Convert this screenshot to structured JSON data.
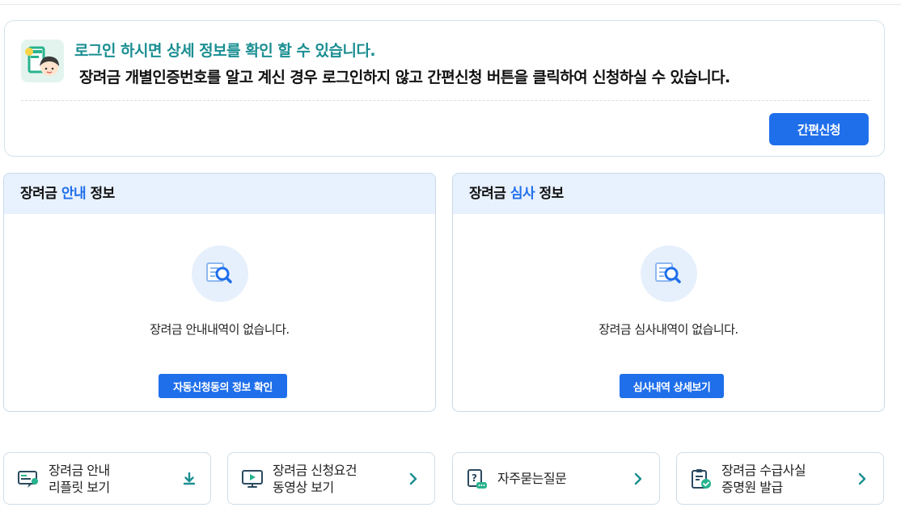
{
  "notice": {
    "title": "로그인 하시면 상세 정보를 확인 할 수 있습니다.",
    "description": "장려금 개별인증번호를 알고 계신 경우 로그인하지 않고 간편신청 버튼을 클릭하여 신청하실 수 있습니다.",
    "quick_apply_label": "간편신청",
    "icon": "person-document-icon"
  },
  "panels": {
    "guide": {
      "title_pre": "장려금 ",
      "title_accent": "안내",
      "title_post": " 정보",
      "empty_text": "장려금 안내내역이 없습니다.",
      "button_label": "자동신청동의 정보 확인",
      "icon": "document-search-icon"
    },
    "review": {
      "title_pre": "장려금 ",
      "title_accent": "심사",
      "title_post": " 정보",
      "empty_text": "장려금 심사내역이 없습니다.",
      "button_label": "심사내역 상세보기",
      "icon": "document-search-icon"
    }
  },
  "quick_links": [
    {
      "line1": "장려금 안내",
      "line2": "리플릿 보기",
      "icon": "leaflet-icon",
      "action_icon": "download-icon"
    },
    {
      "line1": "장려금 신청요건",
      "line2": "동영상 보기",
      "icon": "video-monitor-icon",
      "action_icon": "chevron-right-icon"
    },
    {
      "line1": "자주묻는질문",
      "line2": "",
      "icon": "faq-icon",
      "action_icon": "chevron-right-icon"
    },
    {
      "line1": "장려금 수급사실",
      "line2": "증명원 발급",
      "icon": "certificate-icon",
      "action_icon": "chevron-right-icon"
    }
  ],
  "colors": {
    "primary": "#1f6feb",
    "teal": "#1a8e92",
    "icon_navy": "#2b4a5f",
    "icon_green": "#27b38d",
    "panel_header_bg": "#e8f1fe"
  }
}
